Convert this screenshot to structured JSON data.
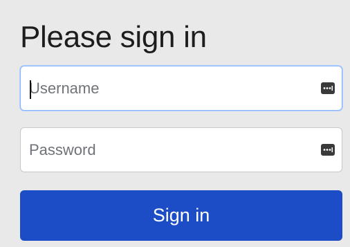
{
  "form": {
    "heading": "Please sign in",
    "username": {
      "placeholder": "Username",
      "value": ""
    },
    "password": {
      "placeholder": "Password",
      "value": ""
    },
    "submit_label": "Sign in"
  },
  "icons": {
    "username_field_icon": "password-manager-key-icon",
    "password_field_icon": "password-manager-key-icon"
  },
  "colors": {
    "background": "#e9e9e9",
    "primary_button": "#1c4dc6",
    "focus_border": "#86b7fe"
  }
}
